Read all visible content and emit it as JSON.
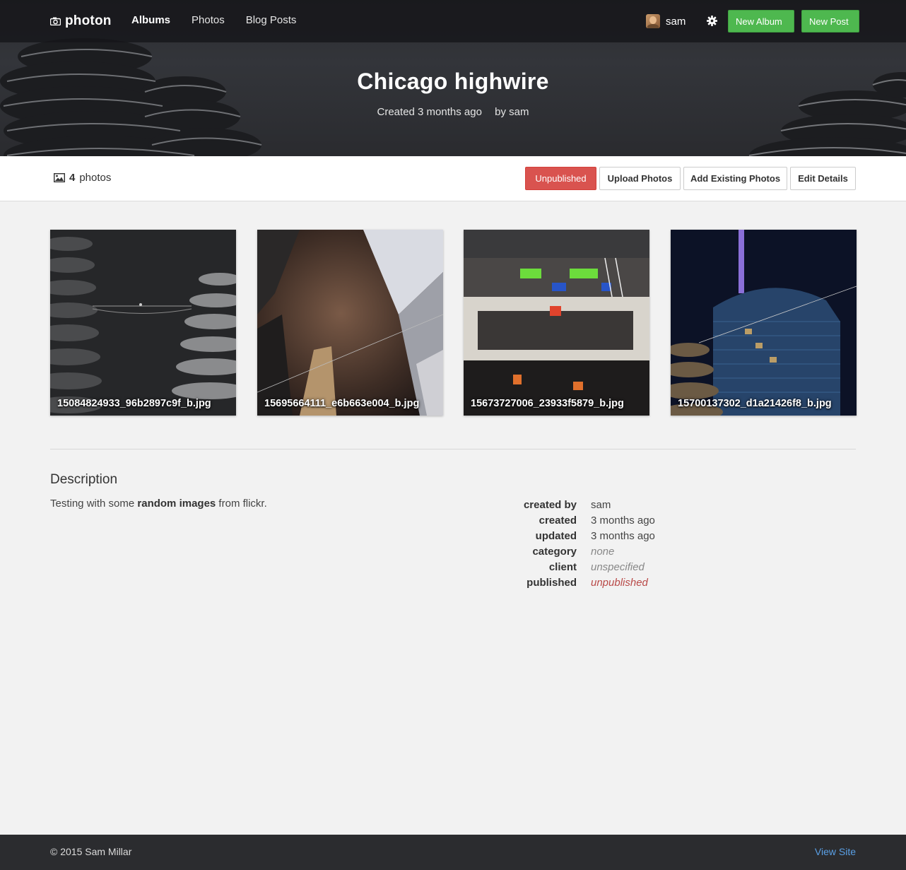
{
  "nav": {
    "brand": "photon",
    "links": [
      "Albums",
      "Photos",
      "Blog Posts"
    ],
    "user_name": "sam",
    "new_album_label": "New Album",
    "new_post_label": "New Post"
  },
  "hero": {
    "title": "Chicago highwire",
    "created": "Created 3 months ago",
    "by": "by sam"
  },
  "toolbar": {
    "photo_count": "4",
    "photo_count_suffix": "photos",
    "unpublished_label": "Unpublished",
    "upload_label": "Upload Photos",
    "add_existing_label": "Add Existing Photos",
    "edit_label": "Edit Details"
  },
  "photos": [
    {
      "filename": "15084824933_96b2897c9f_b.jpg"
    },
    {
      "filename": "15695664111_e6b663e004_b.jpg"
    },
    {
      "filename": "15673727006_23933f5879_b.jpg"
    },
    {
      "filename": "15700137302_d1a21426f8_b.jpg"
    }
  ],
  "description": {
    "title": "Description",
    "text_before": "Testing with some ",
    "text_bold": "random images",
    "text_after": " from flickr."
  },
  "details": [
    {
      "key": "created by",
      "value": "sam"
    },
    {
      "key": "created",
      "value": "3 months ago"
    },
    {
      "key": "updated",
      "value": "3 months ago"
    },
    {
      "key": "category",
      "value": "none"
    },
    {
      "key": "client",
      "value": "unspecified"
    },
    {
      "key": "published",
      "value": "unpublished"
    }
  ],
  "footer": {
    "copyright": "© 2015 Sam Millar",
    "view_site": "View Site"
  },
  "colors": {
    "green_button": "#4eb84f",
    "danger_button": "#d9534f",
    "link": "#5aa0e6"
  }
}
